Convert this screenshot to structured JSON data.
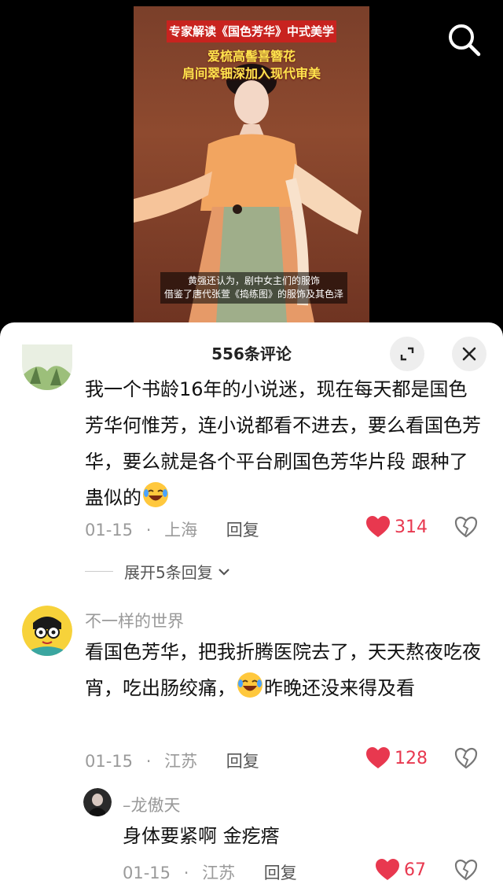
{
  "video": {
    "caption_red": "专家解读《国色芳华》中式美学",
    "caption_line1": "爱梳高髻喜簪花",
    "caption_line2": "肩间翠钿深加入现代审美",
    "subtitle_line1": "黄强还认为，剧中女主们的服饰",
    "subtitle_line2": "借鉴了唐代张萱《捣练图》的服饰及其色泽",
    "search_icon": "search-icon"
  },
  "comments_panel": {
    "title": "556条评论",
    "expand_icon": "expand-icon",
    "close_icon": "close-icon"
  },
  "comments": [
    {
      "text": "我一个书龄16年的小说迷，现在每天都是国色芳华何惟芳，连小说都看不进去，要么看国色芳华，要么就是各个平台刷国色芳华片段 跟种了蛊似的",
      "emoji": "laughing-crying-emoji",
      "date": "01-15",
      "location": "上海",
      "reply_label": "回复",
      "likes": "314",
      "expand_replies": "展开5条回复"
    },
    {
      "username": "不一样的世界",
      "text_part1": "看国色芳华，把我折腾医院去了，天天熬夜吃夜宵，吃出肠绞痛，",
      "text_part2": "昨晚还没来得及看",
      "date": "01-15",
      "location": "江苏",
      "reply_label": "回复",
      "likes": "128"
    },
    {
      "username": "–龙傲天",
      "text": "身体要紧啊 金疙瘩",
      "date": "01-15",
      "location": "江苏",
      "reply_label": "回复",
      "likes": "67"
    }
  ],
  "colors": {
    "like_red": "#e8384f",
    "caption_red": "#c8231f",
    "caption_yellow": "#ffe34d"
  }
}
